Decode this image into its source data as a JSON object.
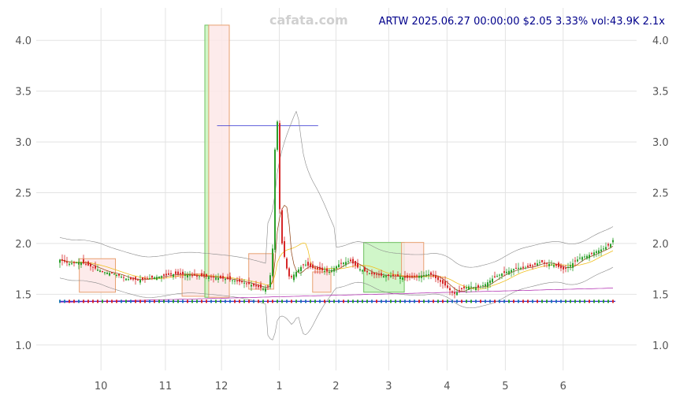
{
  "watermark": "cafata.com",
  "chart_data": {
    "type": "candlestick",
    "title": "ARTW 2025.06.27 00:00:00 $2.05 3.33% vol:43.9K 2.1x",
    "ticker": "ARTW",
    "last_price": 2.05,
    "change_pct": 3.33,
    "volume": "43.9K",
    "volume_ratio": "2.1x",
    "ylim": [
      0.75,
      4.32
    ],
    "y_ticks": [
      "1.0",
      "1.5",
      "2.0",
      "2.5",
      "3.0",
      "3.5",
      "4.0"
    ],
    "x_ticks": [
      "10",
      "11",
      "12",
      "1",
      "2",
      "3",
      "4",
      "5",
      "6"
    ],
    "grid": true,
    "colors": {
      "up": "#2ca02c",
      "down": "#d62728",
      "grid": "#e3e3e3",
      "title": "#00008b"
    },
    "price_path": [
      [
        0,
        1.84
      ],
      [
        12,
        1.8
      ],
      [
        25,
        1.82
      ],
      [
        40,
        1.77
      ],
      [
        55,
        1.72
      ],
      [
        70,
        1.7
      ],
      [
        85,
        1.65
      ],
      [
        100,
        1.64
      ],
      [
        115,
        1.66
      ],
      [
        130,
        1.68
      ],
      [
        145,
        1.7
      ],
      [
        160,
        1.69
      ],
      [
        175,
        1.68
      ],
      [
        190,
        1.67
      ],
      [
        200,
        1.66
      ],
      [
        212,
        1.65
      ],
      [
        224,
        1.63
      ],
      [
        236,
        1.61
      ],
      [
        248,
        1.58
      ],
      [
        260,
        1.55
      ],
      [
        266,
        1.6
      ],
      [
        270,
        1.95
      ],
      [
        272,
        2.25
      ],
      [
        274,
        3.6
      ],
      [
        276,
        3.2
      ],
      [
        278,
        2.45
      ],
      [
        282,
        2.0
      ],
      [
        287,
        1.78
      ],
      [
        292,
        1.65
      ],
      [
        300,
        1.72
      ],
      [
        310,
        1.8
      ],
      [
        320,
        1.76
      ],
      [
        330,
        1.74
      ],
      [
        342,
        1.72
      ],
      [
        355,
        1.8
      ],
      [
        368,
        1.83
      ],
      [
        380,
        1.75
      ],
      [
        395,
        1.7
      ],
      [
        410,
        1.68
      ],
      [
        425,
        1.68
      ],
      [
        440,
        1.66
      ],
      [
        455,
        1.68
      ],
      [
        470,
        1.7
      ],
      [
        480,
        1.64
      ],
      [
        490,
        1.58
      ],
      [
        500,
        1.5
      ],
      [
        510,
        1.55
      ],
      [
        520,
        1.58
      ],
      [
        530,
        1.56
      ],
      [
        540,
        1.6
      ],
      [
        550,
        1.66
      ],
      [
        560,
        1.7
      ],
      [
        570,
        1.73
      ],
      [
        580,
        1.76
      ],
      [
        590,
        1.76
      ],
      [
        600,
        1.78
      ],
      [
        610,
        1.82
      ],
      [
        620,
        1.8
      ],
      [
        630,
        1.78
      ],
      [
        640,
        1.74
      ],
      [
        650,
        1.8
      ],
      [
        660,
        1.86
      ],
      [
        670,
        1.88
      ],
      [
        680,
        1.92
      ],
      [
        690,
        1.95
      ],
      [
        700,
        2.0
      ],
      [
        703,
        2.05
      ]
    ],
    "boxes": [
      {
        "x0": 0.035,
        "x1": 0.1,
        "y0": 1.52,
        "y1": 1.85,
        "fill": "#fde8e8",
        "stroke": "#e8a070"
      },
      {
        "x0": 0.22,
        "x1": 0.262,
        "y0": 1.48,
        "y1": 1.7,
        "fill": "#fde8e8",
        "stroke": "#e8a070"
      },
      {
        "x0": 0.261,
        "x1": 0.268,
        "y0": 1.47,
        "y1": 4.15,
        "fill": "#c8f5c0",
        "stroke": "#70c060"
      },
      {
        "x0": 0.268,
        "x1": 0.305,
        "y0": 1.47,
        "y1": 4.15,
        "fill": "#fde8e8",
        "stroke": "#e8a070"
      },
      {
        "x0": 0.34,
        "x1": 0.385,
        "y0": 1.55,
        "y1": 1.9,
        "fill": "#fde8e8",
        "stroke": "#e8a070"
      },
      {
        "x0": 0.455,
        "x1": 0.488,
        "y0": 1.52,
        "y1": 1.72,
        "fill": "#fde8e8",
        "stroke": "#e8a070"
      },
      {
        "x0": 0.547,
        "x1": 0.62,
        "y0": 1.52,
        "y1": 2.01,
        "fill": "#c8f5c0",
        "stroke": "#70c060"
      },
      {
        "x0": 0.615,
        "x1": 0.655,
        "y0": 1.68,
        "y1": 2.01,
        "fill": "#fde8e8",
        "stroke": "#e8a070"
      }
    ],
    "resistance_line": {
      "x0": 0.283,
      "x1": 0.465,
      "y": 3.16,
      "color": "#3030d0"
    },
    "support_line": {
      "x0": 0.0,
      "x1": 1.0,
      "y": 1.43,
      "color": "#3030d0"
    }
  }
}
